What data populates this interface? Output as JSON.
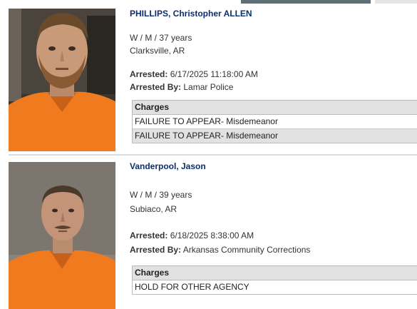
{
  "inmates": [
    {
      "name": "PHILLIPS, Christopher ALLEN",
      "demographics": "W / M / 37 years",
      "city": "Clarksville, AR",
      "arrested_label": "Arrested:",
      "arrested_value": "6/17/2025 11:18:00 AM",
      "arrested_by_label": "Arrested By:",
      "arrested_by_value": "Lamar Police",
      "charges_header": "Charges",
      "charges": [
        "FAILURE TO APPEAR- Misdemeanor",
        "FAILURE TO APPEAR- Misdemeanor"
      ]
    },
    {
      "name": "Vanderpool, Jason",
      "demographics": "W / M / 39 years",
      "city": "Subiaco, AR",
      "arrested_label": "Arrested:",
      "arrested_value": "6/18/2025 8:38:00 AM",
      "arrested_by_label": "Arrested By:",
      "arrested_by_value": "Arkansas Community Corrections",
      "charges_header": "Charges",
      "charges": [
        "HOLD FOR OTHER AGENCY"
      ]
    }
  ],
  "colors": {
    "name_link": "#0a2f6d",
    "charges_header_bg": "#e1e1e1",
    "jumpsuit": "#f07a1e"
  }
}
